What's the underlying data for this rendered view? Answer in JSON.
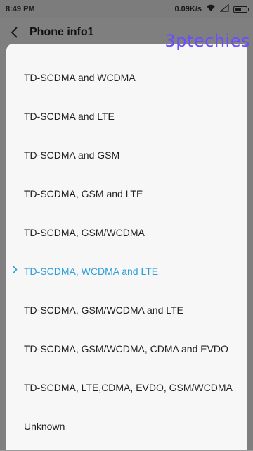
{
  "status": {
    "time": "8:49 PM",
    "speed": "0.09K/s",
    "battery_level": 0.6
  },
  "header": {
    "back_icon": "chevron-left-icon",
    "title": "Phone info1"
  },
  "watermark": "3ptechies",
  "dialog": {
    "partial_item": "...",
    "options": [
      {
        "label": "TD-SCDMA and WCDMA",
        "selected": false
      },
      {
        "label": "TD-SCDMA and LTE",
        "selected": false
      },
      {
        "label": "TD-SCDMA and GSM",
        "selected": false
      },
      {
        "label": "TD-SCDMA, GSM and LTE",
        "selected": false
      },
      {
        "label": "TD-SCDMA, GSM/WCDMA",
        "selected": false
      },
      {
        "label": "TD-SCDMA, WCDMA and LTE",
        "selected": true
      },
      {
        "label": "TD-SCDMA, GSM/WCDMA and LTE",
        "selected": false
      },
      {
        "label": "TD-SCDMA, GSM/WCDMA, CDMA and EVDO",
        "selected": false
      },
      {
        "label": "TD-SCDMA, LTE,CDMA, EVDO, GSM/WCDMA",
        "selected": false
      },
      {
        "label": "Unknown",
        "selected": false
      }
    ],
    "selected_color": "#2b9ed8"
  }
}
